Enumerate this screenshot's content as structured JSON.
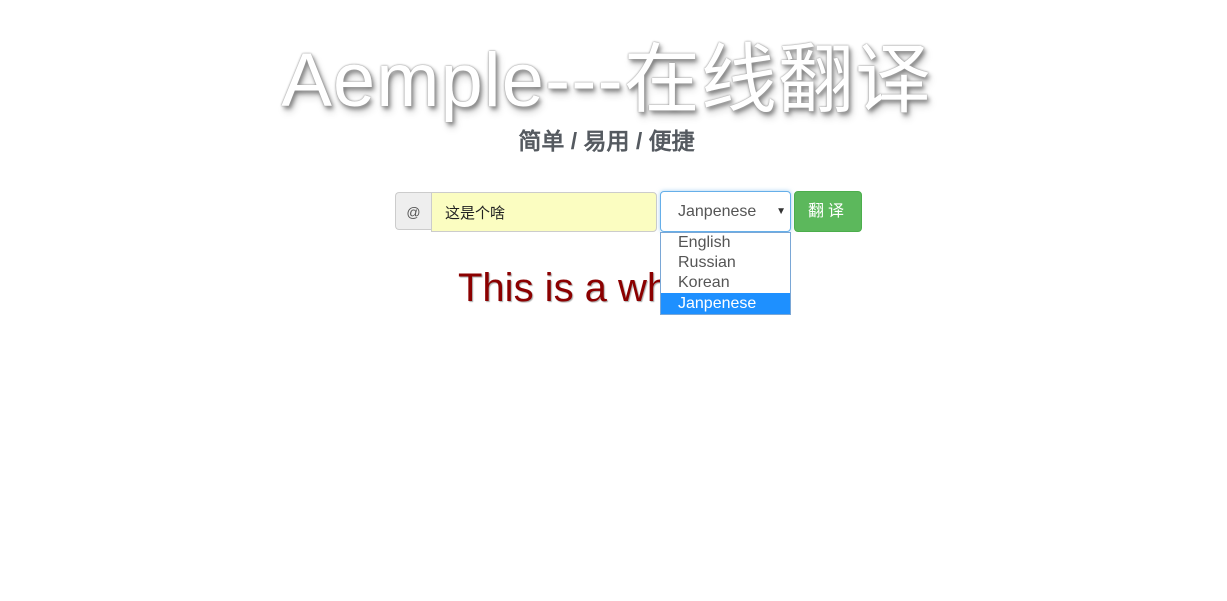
{
  "header": {
    "title": "Aemple---在线翻译",
    "subtitle": "简单 / 易用 / 便捷"
  },
  "form": {
    "addon_label": "@",
    "input_value": "这是个啥",
    "select": {
      "selected": "Janpenese",
      "options": [
        "English",
        "Russian",
        "Korean",
        "Janpenese"
      ]
    },
    "translate_label": "翻译"
  },
  "result": {
    "text": "This is a wh"
  },
  "colors": {
    "input_background": "#fbfdc1",
    "button_green": "#5cb85c",
    "result_text": "#8b0000",
    "selected_option": "#1e90ff"
  }
}
